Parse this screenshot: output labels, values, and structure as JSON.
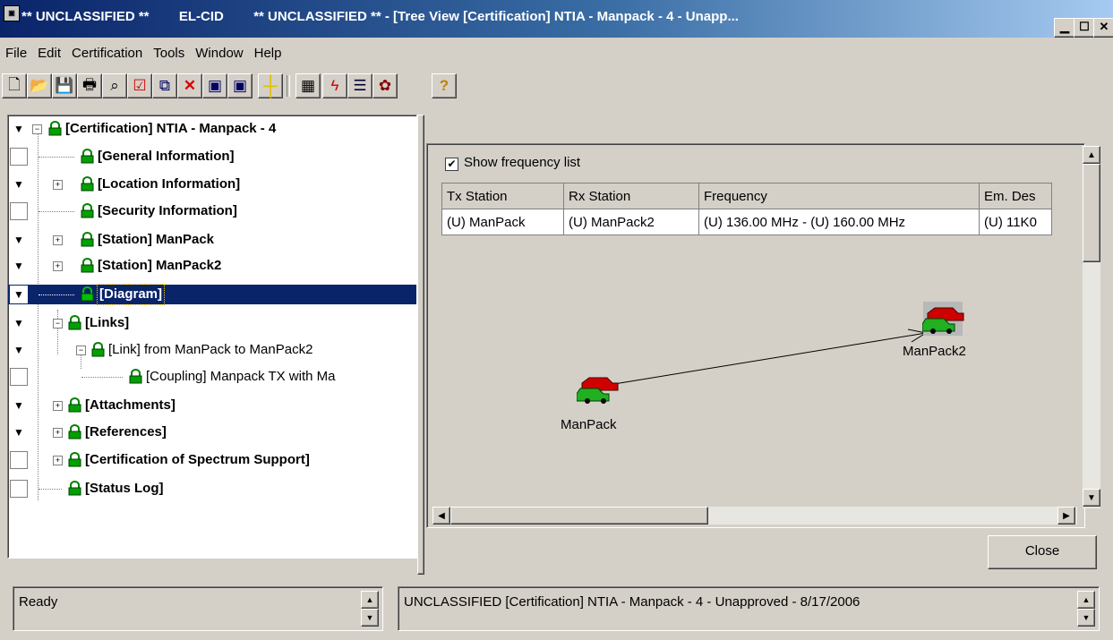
{
  "window": {
    "title": "** UNCLASSIFIED **        EL-CID        ** UNCLASSIFIED ** - [Tree View [Certification] NTIA - Manpack - 4 - Unapp..."
  },
  "menu": [
    "File",
    "Edit",
    "Certification",
    "Tools",
    "Window",
    "Help"
  ],
  "toolbar": {
    "icons": [
      "new-icon",
      "open-icon",
      "save-icon",
      "print-icon",
      "find-icon",
      "validate-icon",
      "copy-icon",
      "delete-icon",
      "export-icon",
      "import-icon",
      "crosshair-icon",
      "calculator-icon",
      "lightning-icon",
      "list-icon",
      "settings-icon",
      "help-icon"
    ]
  },
  "tree": {
    "items": [
      {
        "label": "[Certification] NTIA - Manpack - 4",
        "bold": true
      },
      {
        "label": "[General Information]",
        "bold": true
      },
      {
        "label": "[Location Information]",
        "bold": true
      },
      {
        "label": "[Security Information]",
        "bold": true
      },
      {
        "label": "[Station] ManPack",
        "bold": true
      },
      {
        "label": "[Station] ManPack2",
        "bold": true
      },
      {
        "label": "[Diagram]",
        "bold": true,
        "selected": true
      },
      {
        "label": "[Links]",
        "bold": true
      },
      {
        "label": "[Link] from ManPack to ManPack2",
        "bold": false
      },
      {
        "label": "[Coupling] Manpack TX with Ma",
        "bold": false
      },
      {
        "label": "[Attachments]",
        "bold": true
      },
      {
        "label": "[References]",
        "bold": true
      },
      {
        "label": "[Certification of Spectrum Support]",
        "bold": true
      },
      {
        "label": "[Status Log]",
        "bold": true
      }
    ]
  },
  "diagram": {
    "show_frequency_list_label": "Show frequency list",
    "show_frequency_list_checked": true,
    "table": {
      "columns": [
        "Tx Station",
        "Rx Station",
        "Frequency",
        "Em. Des"
      ],
      "rows": [
        [
          "(U) ManPack",
          "(U) ManPack2",
          "(U) 136.00 MHz - (U) 160.00 MHz",
          "(U) 11K0"
        ]
      ]
    },
    "nodes": {
      "tx": "ManPack",
      "rx": "ManPack2"
    },
    "close_label": "Close"
  },
  "status": {
    "left": "Ready",
    "right": "UNCLASSIFIED [Certification] NTIA - Manpack - 4 - Unapproved - 8/17/2006"
  },
  "colors": {
    "selection": "#0a246a",
    "title_gradient_start": "#0a246a",
    "lock_green": "#008000"
  }
}
